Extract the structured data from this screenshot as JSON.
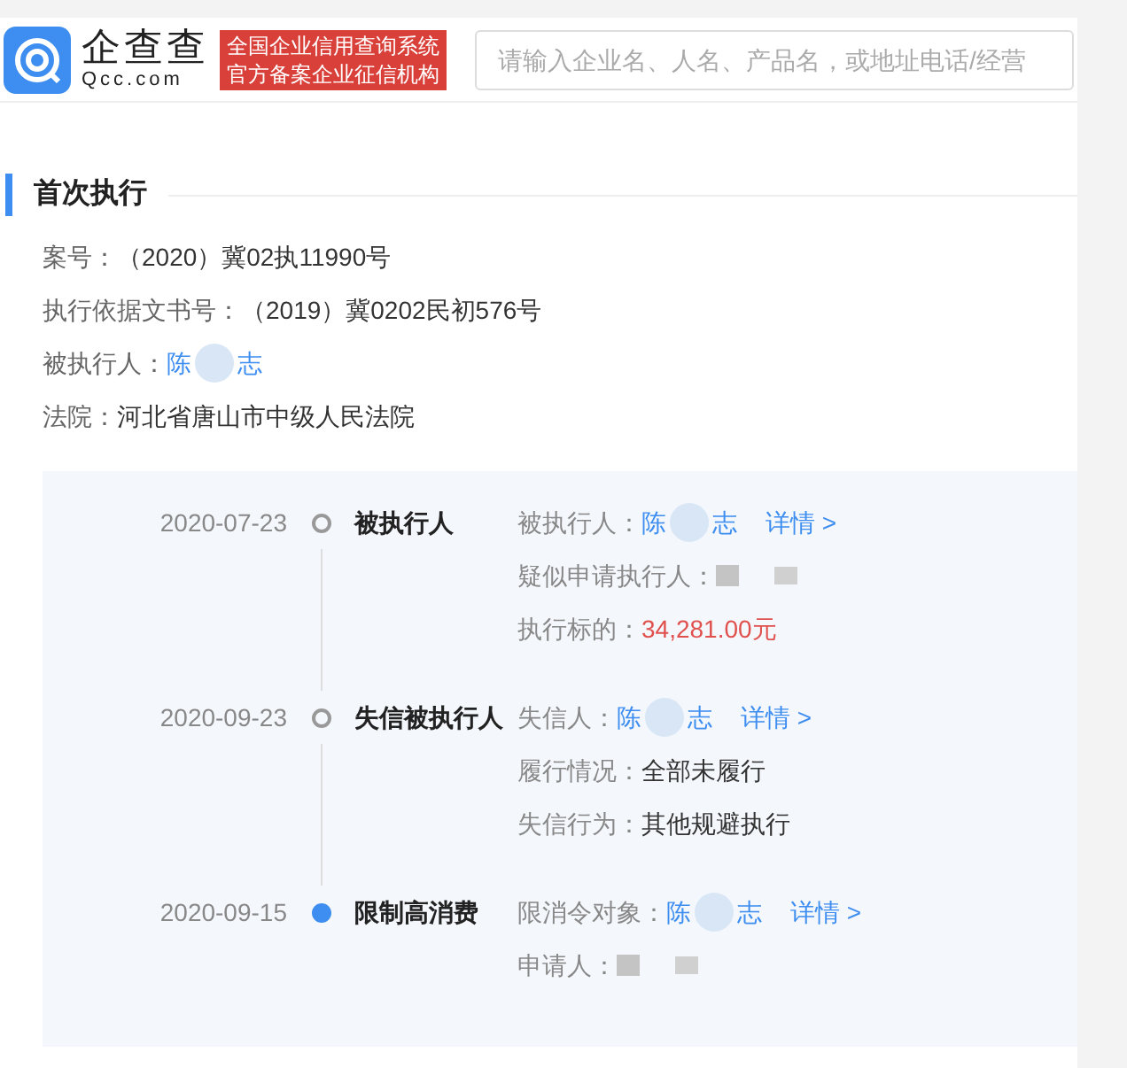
{
  "header": {
    "brand": "企查查",
    "domain": "Qcc.com",
    "badge_lines": [
      "全国企业信用查询系统",
      "官方备案企业征信机构"
    ],
    "search": {
      "placeholder": "请输入企业名、人名、产品名，或地址电话/经营"
    }
  },
  "section": {
    "title": "首次执行",
    "fields": [
      {
        "label": "案号：",
        "kind": "text",
        "value": "（2020）冀02执11990号"
      },
      {
        "label": "执行依据文书号：",
        "kind": "text",
        "value": "（2019）冀0202民初576号"
      },
      {
        "label": "被执行人：",
        "kind": "name",
        "name_parts": [
          "陈",
          "志"
        ]
      },
      {
        "label": "法院：",
        "kind": "text",
        "value": "河北省唐山市中级人民法院"
      }
    ]
  },
  "timeline": [
    {
      "date": "2020-07-23",
      "selected": false,
      "title": "被执行人",
      "rows": [
        {
          "label": "被执行人：",
          "kind": "name",
          "name_parts": [
            "陈",
            "志"
          ],
          "link": "详情 >"
        },
        {
          "label": "疑似申请执行人：",
          "kind": "redacted"
        },
        {
          "label": "执行标的：",
          "kind": "amount",
          "value": "34,281.00元"
        }
      ]
    },
    {
      "date": "2020-09-23",
      "selected": false,
      "title": "失信被执行人",
      "rows": [
        {
          "label": "失信人：",
          "kind": "name",
          "name_parts": [
            "陈",
            "志"
          ],
          "link": "详情 >"
        },
        {
          "label": "履行情况：",
          "kind": "text",
          "value": "全部未履行"
        },
        {
          "label": "失信行为：",
          "kind": "text",
          "value": "其他规避执行"
        }
      ]
    },
    {
      "date": "2020-09-15",
      "selected": true,
      "title": "限制高消费",
      "rows": [
        {
          "label": "限消令对象：",
          "kind": "name",
          "name_parts": [
            "陈",
            "志"
          ],
          "link": "详情 >"
        },
        {
          "label": "申请人：",
          "kind": "redacted"
        }
      ]
    }
  ]
}
